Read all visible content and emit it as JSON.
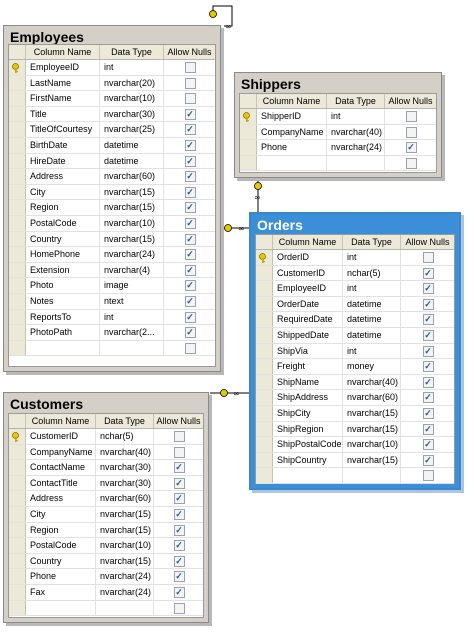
{
  "columns_header": {
    "name": "Column Name",
    "type": "Data Type",
    "nulls": "Allow Nulls"
  },
  "employees": {
    "title": "Employees",
    "rows": [
      {
        "name": "EmployeeID",
        "type": "int",
        "nulls": false,
        "key": true
      },
      {
        "name": "LastName",
        "type": "nvarchar(20)",
        "nulls": false,
        "key": false
      },
      {
        "name": "FirstName",
        "type": "nvarchar(10)",
        "nulls": false,
        "key": false
      },
      {
        "name": "Title",
        "type": "nvarchar(30)",
        "nulls": true,
        "key": false
      },
      {
        "name": "TitleOfCourtesy",
        "type": "nvarchar(25)",
        "nulls": true,
        "key": false
      },
      {
        "name": "BirthDate",
        "type": "datetime",
        "nulls": true,
        "key": false
      },
      {
        "name": "HireDate",
        "type": "datetime",
        "nulls": true,
        "key": false
      },
      {
        "name": "Address",
        "type": "nvarchar(60)",
        "nulls": true,
        "key": false
      },
      {
        "name": "City",
        "type": "nvarchar(15)",
        "nulls": true,
        "key": false
      },
      {
        "name": "Region",
        "type": "nvarchar(15)",
        "nulls": true,
        "key": false
      },
      {
        "name": "PostalCode",
        "type": "nvarchar(10)",
        "nulls": true,
        "key": false
      },
      {
        "name": "Country",
        "type": "nvarchar(15)",
        "nulls": true,
        "key": false
      },
      {
        "name": "HomePhone",
        "type": "nvarchar(24)",
        "nulls": true,
        "key": false
      },
      {
        "name": "Extension",
        "type": "nvarchar(4)",
        "nulls": true,
        "key": false
      },
      {
        "name": "Photo",
        "type": "image",
        "nulls": true,
        "key": false
      },
      {
        "name": "Notes",
        "type": "ntext",
        "nulls": true,
        "key": false
      },
      {
        "name": "ReportsTo",
        "type": "int",
        "nulls": true,
        "key": false
      },
      {
        "name": "PhotoPath",
        "type": "nvarchar(2...",
        "nulls": true,
        "key": false
      },
      {
        "name": "",
        "type": "",
        "nulls": false,
        "key": false
      }
    ]
  },
  "shippers": {
    "title": "Shippers",
    "rows": [
      {
        "name": "ShipperID",
        "type": "int",
        "nulls": false,
        "key": true
      },
      {
        "name": "CompanyName",
        "type": "nvarchar(40)",
        "nulls": false,
        "key": false
      },
      {
        "name": "Phone",
        "type": "nvarchar(24)",
        "nulls": true,
        "key": false
      },
      {
        "name": "",
        "type": "",
        "nulls": false,
        "key": false
      }
    ]
  },
  "orders": {
    "title": "Orders",
    "rows": [
      {
        "name": "OrderID",
        "type": "int",
        "nulls": false,
        "key": true
      },
      {
        "name": "CustomerID",
        "type": "nchar(5)",
        "nulls": true,
        "key": false
      },
      {
        "name": "EmployeeID",
        "type": "int",
        "nulls": true,
        "key": false
      },
      {
        "name": "OrderDate",
        "type": "datetime",
        "nulls": true,
        "key": false
      },
      {
        "name": "RequiredDate",
        "type": "datetime",
        "nulls": true,
        "key": false
      },
      {
        "name": "ShippedDate",
        "type": "datetime",
        "nulls": true,
        "key": false
      },
      {
        "name": "ShipVia",
        "type": "int",
        "nulls": true,
        "key": false
      },
      {
        "name": "Freight",
        "type": "money",
        "nulls": true,
        "key": false
      },
      {
        "name": "ShipName",
        "type": "nvarchar(40)",
        "nulls": true,
        "key": false
      },
      {
        "name": "ShipAddress",
        "type": "nvarchar(60)",
        "nulls": true,
        "key": false
      },
      {
        "name": "ShipCity",
        "type": "nvarchar(15)",
        "nulls": true,
        "key": false
      },
      {
        "name": "ShipRegion",
        "type": "nvarchar(15)",
        "nulls": true,
        "key": false
      },
      {
        "name": "ShipPostalCode",
        "type": "nvarchar(10)",
        "nulls": true,
        "key": false
      },
      {
        "name": "ShipCountry",
        "type": "nvarchar(15)",
        "nulls": true,
        "key": false
      },
      {
        "name": "",
        "type": "",
        "nulls": false,
        "key": false
      }
    ]
  },
  "customers": {
    "title": "Customers",
    "rows": [
      {
        "name": "CustomerID",
        "type": "nchar(5)",
        "nulls": false,
        "key": true
      },
      {
        "name": "CompanyName",
        "type": "nvarchar(40)",
        "nulls": false,
        "key": false
      },
      {
        "name": "ContactName",
        "type": "nvarchar(30)",
        "nulls": true,
        "key": false
      },
      {
        "name": "ContactTitle",
        "type": "nvarchar(30)",
        "nulls": true,
        "key": false
      },
      {
        "name": "Address",
        "type": "nvarchar(60)",
        "nulls": true,
        "key": false
      },
      {
        "name": "City",
        "type": "nvarchar(15)",
        "nulls": true,
        "key": false
      },
      {
        "name": "Region",
        "type": "nvarchar(15)",
        "nulls": true,
        "key": false
      },
      {
        "name": "PostalCode",
        "type": "nvarchar(10)",
        "nulls": true,
        "key": false
      },
      {
        "name": "Country",
        "type": "nvarchar(15)",
        "nulls": true,
        "key": false
      },
      {
        "name": "Phone",
        "type": "nvarchar(24)",
        "nulls": true,
        "key": false
      },
      {
        "name": "Fax",
        "type": "nvarchar(24)",
        "nulls": true,
        "key": false
      },
      {
        "name": "",
        "type": "",
        "nulls": false,
        "key": false
      }
    ]
  },
  "colors": {
    "selected_border": "#3c87c8",
    "selected_title_bg": "#3a8fd8",
    "key_color": "#e8c800",
    "frame": "#d4d0c8"
  },
  "icons": {
    "primary_key": "key-icon",
    "relationship_key_end": "key-icon",
    "relationship_many_end": "infinity-icon",
    "checkbox": "checkbox-icon"
  }
}
